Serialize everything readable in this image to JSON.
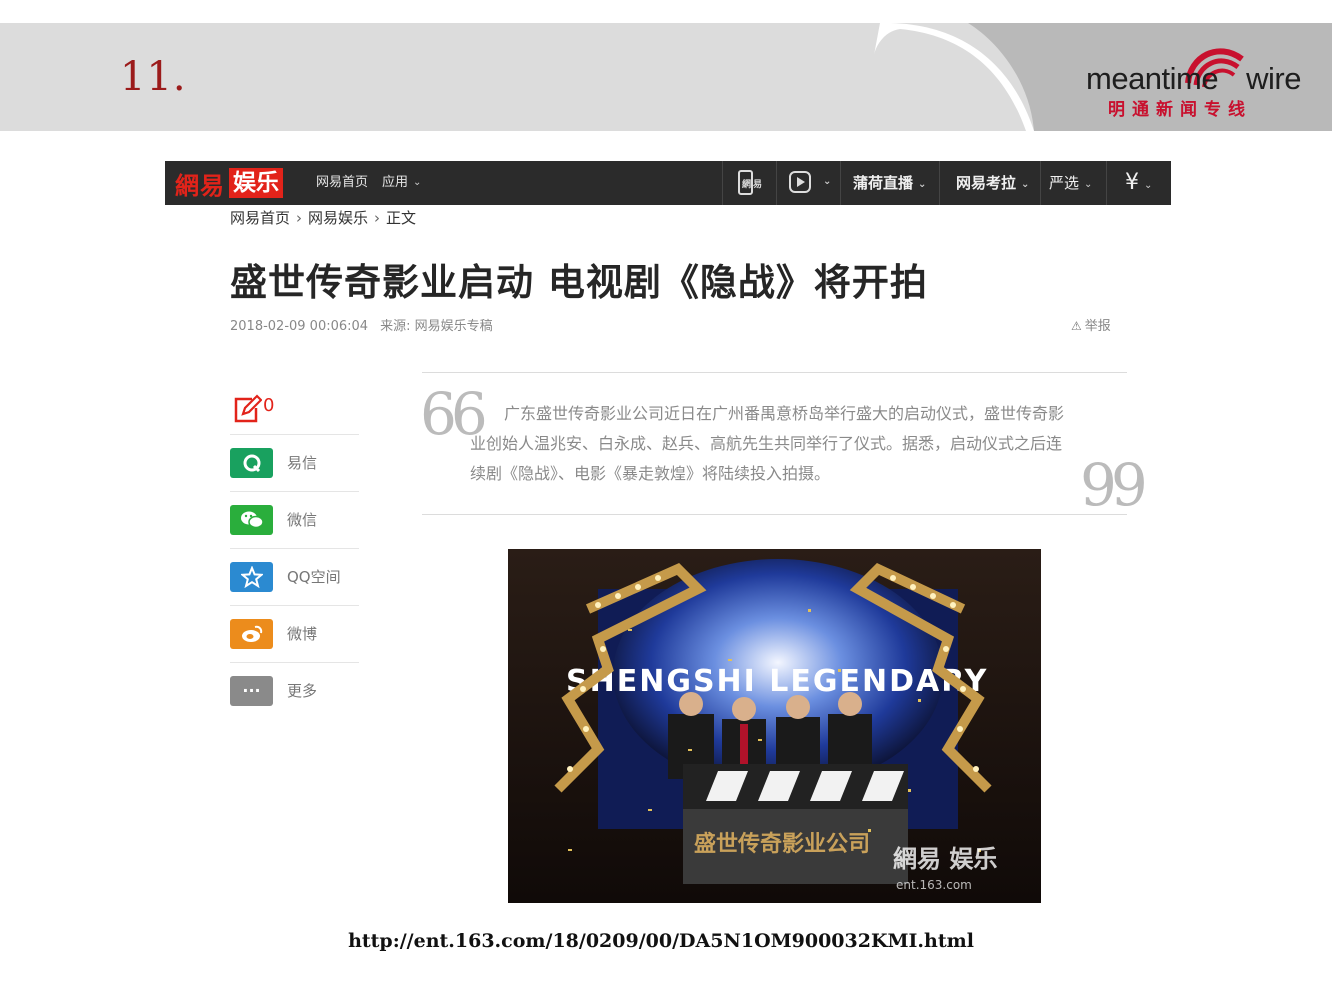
{
  "slide": {
    "number": "11.",
    "brand_en_left": "meantime",
    "brand_en_right": "wire",
    "brand_cn": "明通新闻专线",
    "brand_color": "#c8102e",
    "source_url": "http://ent.163.com/18/0209/00/DA5N1OM900032KMI.html"
  },
  "site_nav": {
    "logo_part1": "網易",
    "logo_part2": "娱乐",
    "links": [
      "网易首页",
      "应用"
    ],
    "right_items": [
      "蒲荷直播",
      "网易考拉",
      "严选"
    ],
    "icons": [
      "phone-app-icon",
      "play-video-icon",
      "yuan-icon"
    ],
    "phone_icon_text": "網易"
  },
  "breadcrumb": [
    "网易首页",
    "网易娱乐",
    "正文"
  ],
  "article": {
    "title": "盛世传奇影业启动 电视剧《隐战》将开拍",
    "datetime": "2018-02-09 00:06:04",
    "source": "来源: 网易娱乐专稿",
    "report": "举报",
    "comment_count": "0",
    "summary": "广东盛世传奇影业公司近日在广州番禺意桥岛举行盛大的启动仪式，盛世传奇影业创始人温兆安、白永成、赵兵、高航先生共同举行了仪式。据悉，启动仪式之后连续剧《隐战》、电影《暴走敦煌》将陆续投入拍摄。",
    "quote_open": "66",
    "quote_close": "99"
  },
  "share": [
    {
      "label": "易信",
      "color": "#19a15f",
      "icon": "yixin-icon"
    },
    {
      "label": "微信",
      "color": "#2aae3c",
      "icon": "wechat-icon"
    },
    {
      "label": "QQ空间",
      "color": "#2b8ad1",
      "icon": "qzone-star-icon"
    },
    {
      "label": "微博",
      "color": "#ec8c1c",
      "icon": "weibo-icon"
    },
    {
      "label": "更多",
      "color": "#8a8a8a",
      "icon": "more-dots-icon",
      "glyph": "···"
    }
  ],
  "photo": {
    "screen_text": "SHENGSHI LEGENDARY",
    "podium_text": "盛世传奇影业公司",
    "watermark": "網易 娱乐",
    "watermark_url": "ent.163.com"
  }
}
